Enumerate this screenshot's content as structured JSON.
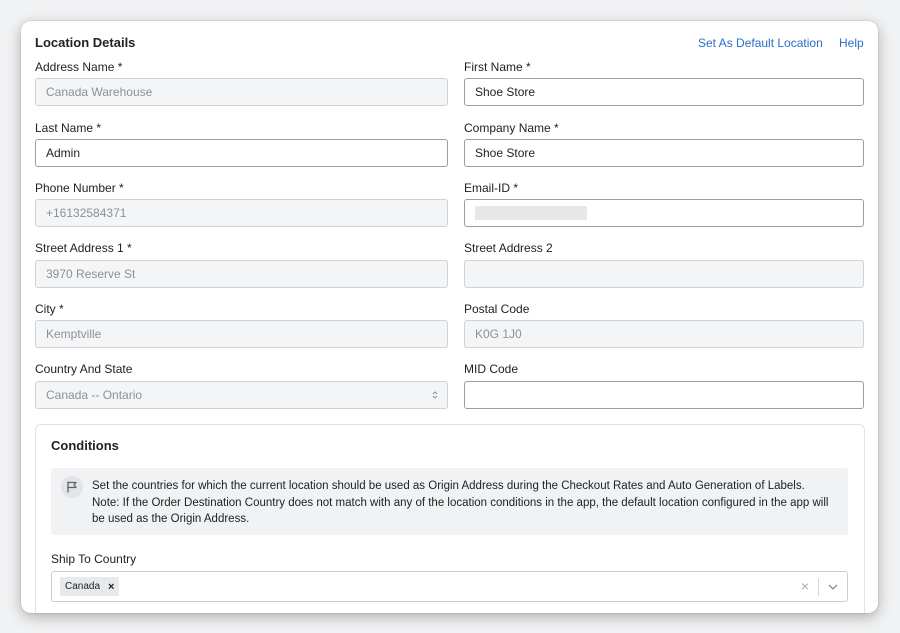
{
  "header": {
    "title": "Location Details",
    "set_default_link": "Set As Default Location",
    "help_link": "Help"
  },
  "form": {
    "address_name": {
      "label": "Address Name *",
      "value": "Canada Warehouse"
    },
    "first_name": {
      "label": "First Name *",
      "value": "Shoe Store"
    },
    "last_name": {
      "label": "Last Name *",
      "value": "Admin"
    },
    "company_name": {
      "label": "Company Name *",
      "value": "Shoe Store"
    },
    "phone_number": {
      "label": "Phone Number *",
      "value": "+16132584371"
    },
    "email_id": {
      "label": "Email-ID *",
      "value": ""
    },
    "street_address_1": {
      "label": "Street Address 1 *",
      "value": "3970 Reserve St"
    },
    "street_address_2": {
      "label": "Street Address 2",
      "value": ""
    },
    "city": {
      "label": "City *",
      "value": "Kemptville"
    },
    "postal_code": {
      "label": "Postal Code",
      "value": "K0G 1J0"
    },
    "country_state": {
      "label": "Country And State",
      "value": "Canada -- Ontario"
    },
    "mid_code": {
      "label": "MID Code",
      "value": ""
    }
  },
  "conditions": {
    "title": "Conditions",
    "banner_icon": "flag-icon",
    "banner_line1": "Set the countries for which the current location should be used as Origin Address during the Checkout Rates and Auto Generation of Labels.",
    "banner_line2": "Note: If the Order Destination Country does not match with any of the location conditions in the app, the default location configured in the app will be used as the Origin  Address.",
    "ship_to_label": "Ship To Country",
    "selected_countries": [
      "Canada"
    ],
    "chip_remove_glyph": "×",
    "clear_glyph": "×"
  },
  "colors": {
    "link": "#2c6ecb",
    "disabled_field_bg": "#f4f5f6",
    "banner_bg": "#f1f2f4"
  }
}
